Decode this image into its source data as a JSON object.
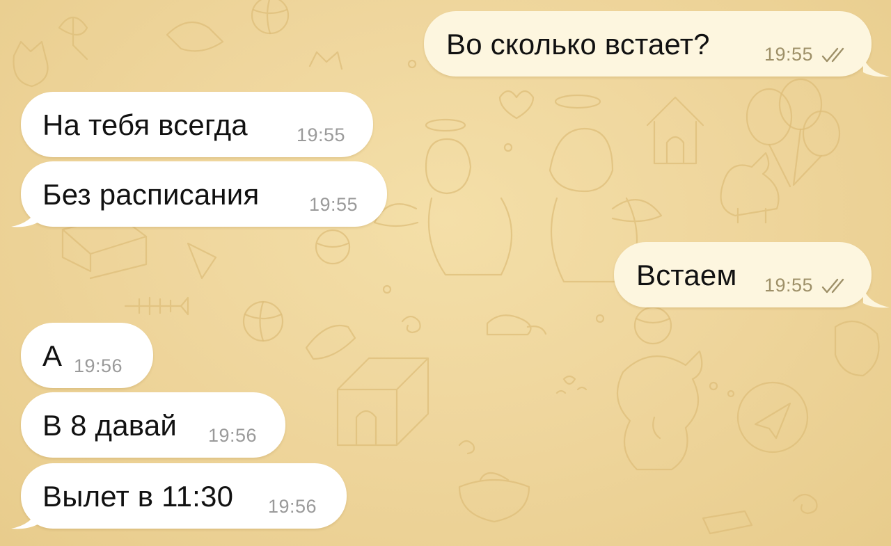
{
  "chat": {
    "messages": [
      {
        "direction": "outgoing",
        "text": "Во сколько встает?",
        "time": "19:55",
        "status": "read-double-check"
      },
      {
        "direction": "incoming",
        "text": "На тебя всегда",
        "time": "19:55"
      },
      {
        "direction": "incoming",
        "text": "Без расписания",
        "time": "19:55"
      },
      {
        "direction": "outgoing",
        "text": "Встаем",
        "time": "19:55",
        "status": "read-double-check"
      },
      {
        "direction": "incoming",
        "text": "А",
        "time": "19:56"
      },
      {
        "direction": "incoming",
        "text": "В 8 давай",
        "time": "19:56"
      },
      {
        "direction": "incoming",
        "text": "Вылет в 11:30",
        "time": "19:56"
      }
    ]
  },
  "theme": {
    "background": "#edd49a",
    "incoming_bubble": "#ffffff",
    "outgoing_bubble": "#fdf6df",
    "outgoing_meta": "#9e9068",
    "incoming_meta": "#9a9a9a",
    "pattern": "cat-and-dog-doodles"
  }
}
